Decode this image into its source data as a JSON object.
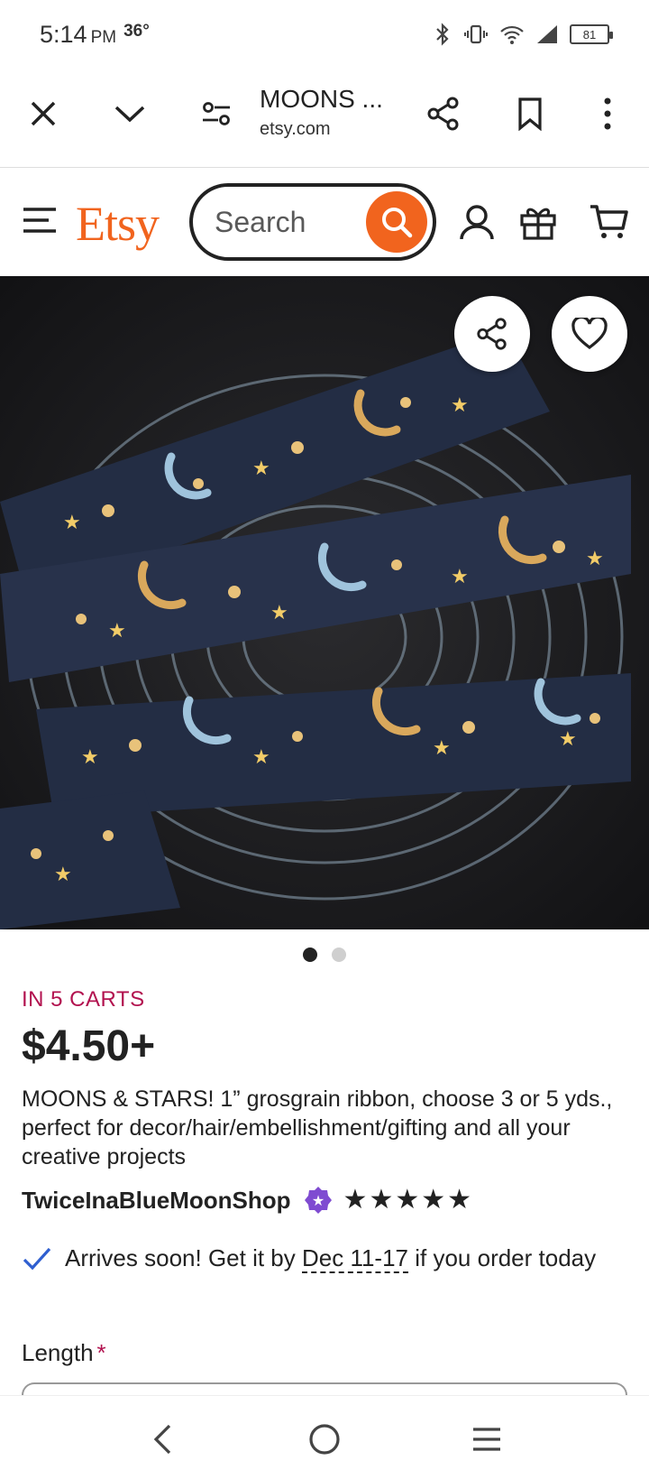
{
  "status_bar": {
    "time": "5:14",
    "ampm": "PM",
    "temp": "36°",
    "battery": "81"
  },
  "browser": {
    "tab_title": "MOONS ...",
    "domain": "etsy.com"
  },
  "header": {
    "logo": "Etsy",
    "search_placeholder": "Search"
  },
  "product": {
    "in_carts": "IN 5 CARTS",
    "price": "$4.50+",
    "title": "MOONS & STARS! 1” grosgrain ribbon, choose 3 or 5 yds., perfect for decor/hair/embellishment/gifting and all your creative projects",
    "shop_name": "TwiceInaBlueMoonShop",
    "rating_stars": 5,
    "arrives_prefix": "Arrives soon! Get it by ",
    "arrives_date": "Dec 11-17",
    "arrives_suffix": " if you order today",
    "length_label": "Length",
    "required_mark": "*",
    "image_count": 2,
    "image_index": 1
  },
  "colors": {
    "brand": "#f1641e",
    "carts": "#b2124f",
    "check": "#2f5fd0"
  }
}
